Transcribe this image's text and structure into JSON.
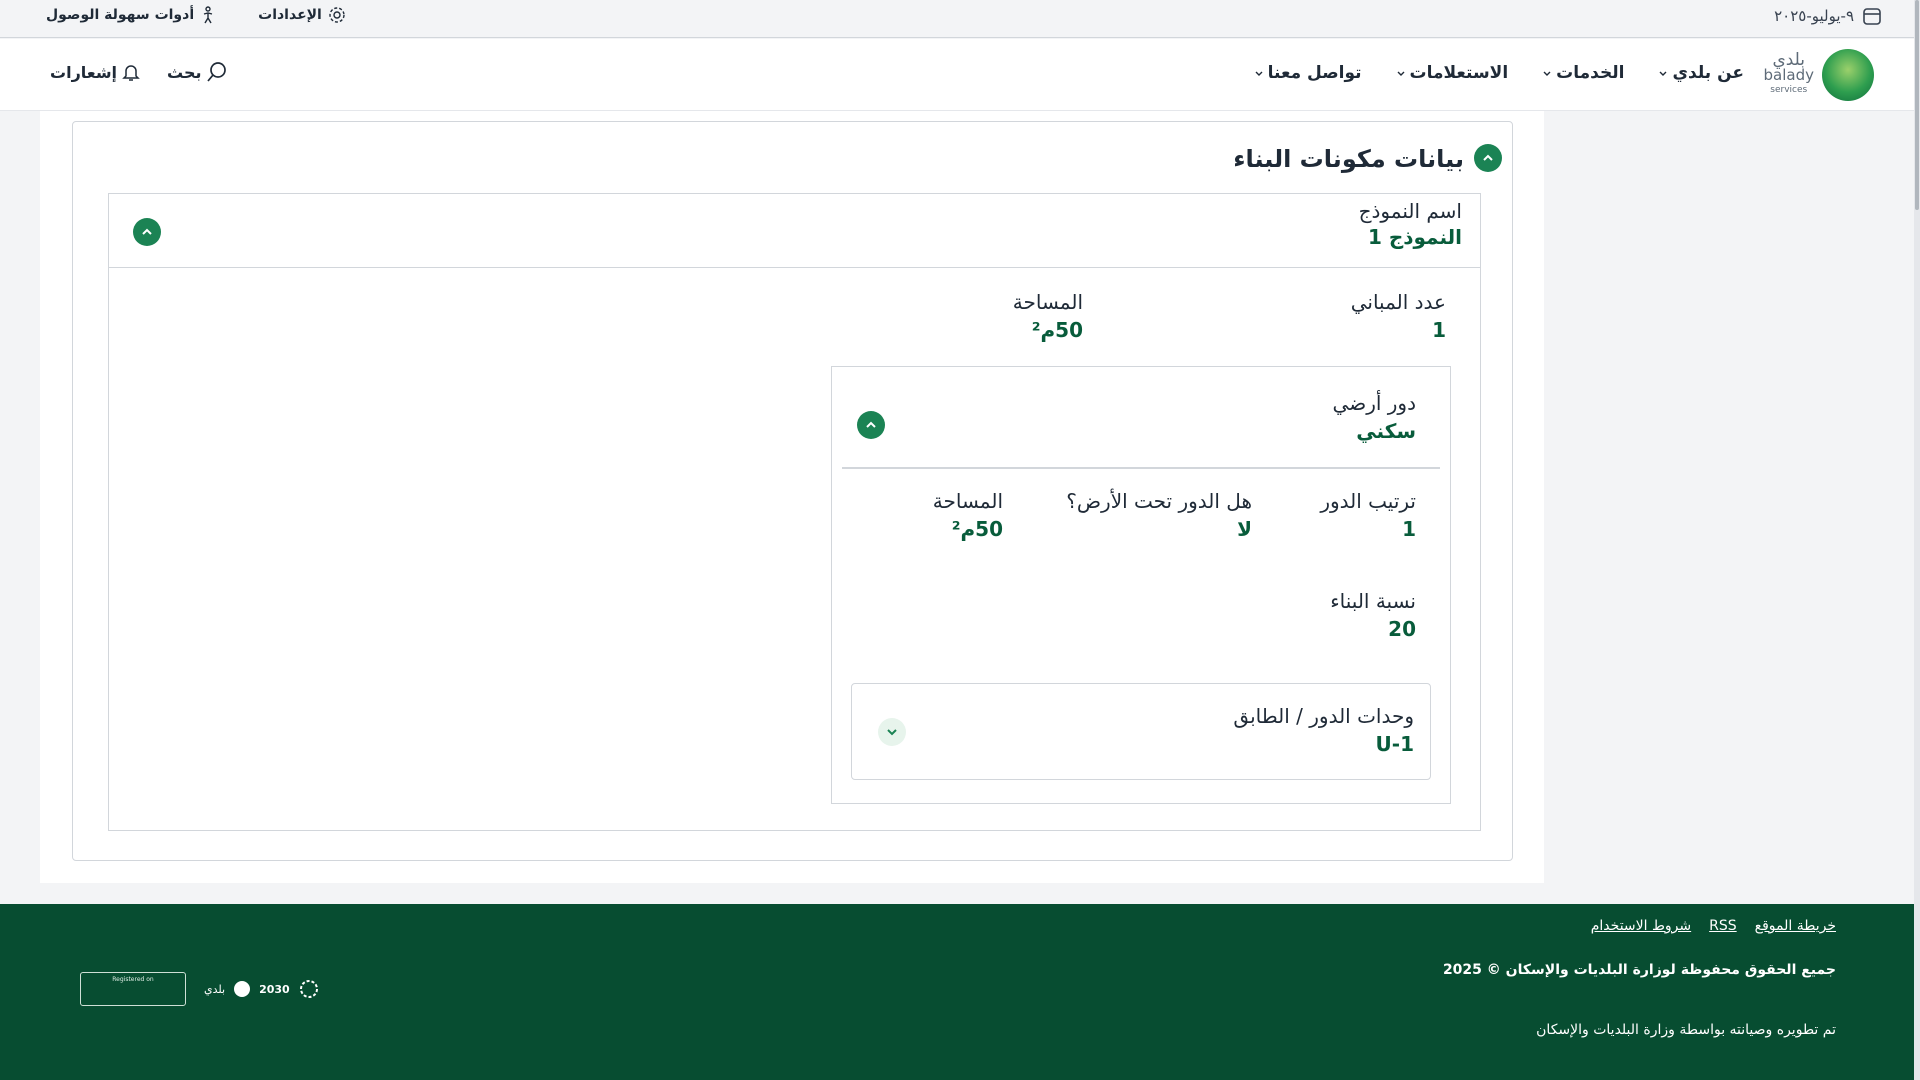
{
  "topbar": {
    "date": "٩-يوليو-٢٠٢٥",
    "settings": "الإعدادات",
    "accessibility": "أدوات سهولة الوصول"
  },
  "header": {
    "logo_ar": "بلدي",
    "logo_en": "balady",
    "logo_sub": "services",
    "nav": [
      "عن بلدي",
      "الخدمات",
      "الاستعلامات",
      "تواصل معنا"
    ],
    "search": "بحث",
    "notifications": "إشعارات"
  },
  "section": {
    "title": "بيانات مكونات البناء"
  },
  "model": {
    "label": "اسم النموذج",
    "value": "النموذج 1"
  },
  "buildings": {
    "count_label": "عدد المباني",
    "count_value": "1",
    "area_label": "المساحة",
    "area_value": "50م²"
  },
  "floor": {
    "type_label": "دور أرضي",
    "type_value": "سكني",
    "order_label": "ترتيب الدور",
    "order_value": "1",
    "underground_label": "هل الدور تحت الأرض؟",
    "underground_value": "لا",
    "area_label": "المساحة",
    "area_value": "50م²",
    "ratio_label": "نسبة البناء",
    "ratio_value": "20"
  },
  "units": {
    "label": "وحدات الدور / الطابق",
    "value": "U-1"
  },
  "footer": {
    "links": [
      "خريطة الموقع",
      "RSS",
      "شروط الاستخدام"
    ],
    "copyright": "جميع الحقوق محفوظة لوزارة البلديات والإسكان © 2025",
    "developed": "تم تطويره وصيانته بواسطة وزارة البلديات والإسكان",
    "vision": "2030",
    "balady_small": "بلدي",
    "reg": "Registered on"
  },
  "colors": {
    "primary": "#1b8354",
    "footer_bg": "#074d31",
    "value_text": "#085c3b"
  }
}
